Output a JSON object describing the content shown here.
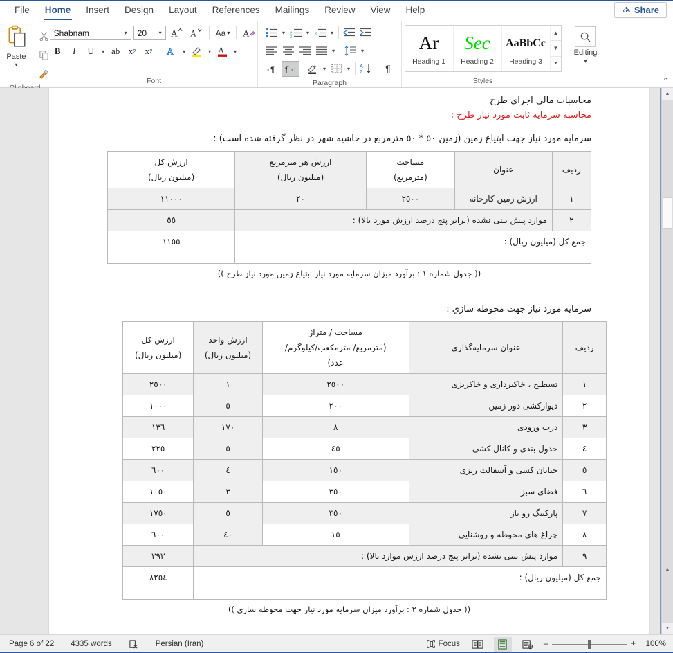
{
  "ribbon": {
    "tabs": [
      {
        "label": "File"
      },
      {
        "label": "Home"
      },
      {
        "label": "Insert"
      },
      {
        "label": "Design"
      },
      {
        "label": "Layout"
      },
      {
        "label": "References"
      },
      {
        "label": "Mailings"
      },
      {
        "label": "Review"
      },
      {
        "label": "View"
      },
      {
        "label": "Help"
      }
    ],
    "active_tab": "Home",
    "share_label": "Share",
    "groups": {
      "clipboard": {
        "label": "Clipboard",
        "paste_label": "Paste"
      },
      "font": {
        "label": "Font",
        "font_name": "Shabnam",
        "font_size": "20"
      },
      "paragraph": {
        "label": "Paragraph"
      },
      "styles": {
        "label": "Styles",
        "items": [
          {
            "preview": "Ar",
            "name": "Heading 1"
          },
          {
            "preview": "Sec",
            "name": "Heading 2"
          },
          {
            "preview": "AaBbCc",
            "name": "Heading 3"
          }
        ]
      },
      "editing": {
        "label": "Editing"
      }
    }
  },
  "document": {
    "heading1": "محاسبات مالی اجرای طرح",
    "heading2": "محاسبه سرمایه ثابت مورد نیاز طرح :",
    "intro1": "سرمایه مورد نیاز جهت ابتیاع زمین (زمین ٥٠ * ٥٠ مترمربع در حاشیه شهر در نظر گرفته شده است) :",
    "intro2": "سرمایه مورد نیاز جهت محوطه سازي :",
    "table1": {
      "headers": [
        "رديف",
        "عنوان",
        "مساحت\n(مترمربع)",
        "ارزش هر مترمربع\n(میلیون ریال)",
        "ارزش کل\n(میلیون ریال)"
      ],
      "headers_split": [
        {
          "l1": "رديف",
          "l2": ""
        },
        {
          "l1": "عنوان",
          "l2": ""
        },
        {
          "l1": "مساحت",
          "l2": "(مترمربع)"
        },
        {
          "l1": "ارزش هر مترمربع",
          "l2": "(میلیون ریال)"
        },
        {
          "l1": "ارزش کل",
          "l2": "(میلیون ریال)"
        }
      ],
      "rows": [
        {
          "no": "١",
          "title": "ارزش زمین کارخانه",
          "area": "٢٥٠٠",
          "unit": "٢٠",
          "total": "١١٠٠٠"
        }
      ],
      "row_contingency": {
        "no": "٢",
        "text": "موارد پیش بینی نشده (برابر پنج درصد ارزش مورد بالا) :",
        "total": "٥٥"
      },
      "row_total": {
        "text": "جمع کل (میلیون ریال) :",
        "total": "١١٥٥"
      },
      "caption": "(( جدول شماره ١ :  برآورد میزان سرمایه مورد نیاز ابتیاع زمین مورد نیاز طرح ))"
    },
    "table2": {
      "headers_split": [
        {
          "l1": "رديف",
          "l2": "",
          "l3": ""
        },
        {
          "l1": "عنوان سرمایه‌گذاری",
          "l2": "",
          "l3": ""
        },
        {
          "l1": "مساحت / متراژ",
          "l2": "(مترمربع/ مترمکعب/کیلوگرم/",
          "l3": "عدد)"
        },
        {
          "l1": "ارزش واحد",
          "l2": "(میلیون ریال)",
          "l3": ""
        },
        {
          "l1": "ارزش کل",
          "l2": "(میلیون ریال)",
          "l3": ""
        }
      ],
      "rows": [
        {
          "no": "١",
          "title": "تسطیح ، خاکبرداری و خاکریزی",
          "area": "٢٥٠٠",
          "unit": "١",
          "total": "٢٥٠٠"
        },
        {
          "no": "٢",
          "title": "دیوارکشی دور زمین",
          "area": "٢٠٠",
          "unit": "٥",
          "total": "١٠٠٠"
        },
        {
          "no": "٣",
          "title": "درب ورودی",
          "area": "٨",
          "unit": "١٧٠",
          "total": "١٣٦"
        },
        {
          "no": "٤",
          "title": "جدول بندی و کانال کشی",
          "area": "٤٥",
          "unit": "٥",
          "total": "٢٢٥"
        },
        {
          "no": "٥",
          "title": "خیابان کشی و آسفالت ریزی",
          "area": "١٥٠",
          "unit": "٤",
          "total": "٦٠٠"
        },
        {
          "no": "٦",
          "title": "فضای سبز",
          "area": "٣٥٠",
          "unit": "٣",
          "total": "١٠٥٠"
        },
        {
          "no": "٧",
          "title": "پارکینگ رو باز",
          "area": "٣٥٠",
          "unit": "٥",
          "total": "١٧٥٠"
        },
        {
          "no": "٨",
          "title": "چراغ های محوطه و روشنایی",
          "area": "١٥",
          "unit": "٤٠",
          "total": "٦٠٠"
        }
      ],
      "row_contingency": {
        "no": "٩",
        "text": "موارد پیش بینی نشده (برابر پنج درصد ارزش موارد بالا) :",
        "total": "٣٩٣"
      },
      "row_total": {
        "text": "جمع کل (میلیون ریال) :",
        "total": "٨٢٥٤"
      },
      "caption": "(( جدول شماره ٢ : برآورد میزان سرمایه مورد نیاز جهت محوطه سازي ))"
    }
  },
  "statusbar": {
    "page": "Page 6 of 22",
    "words": "4335 words",
    "language": "Persian (Iran)",
    "focus": "Focus",
    "zoom": "100%"
  },
  "colors": {
    "accent": "#2b579a",
    "heading_red": "#e02020",
    "table_shade": "#efefef"
  }
}
